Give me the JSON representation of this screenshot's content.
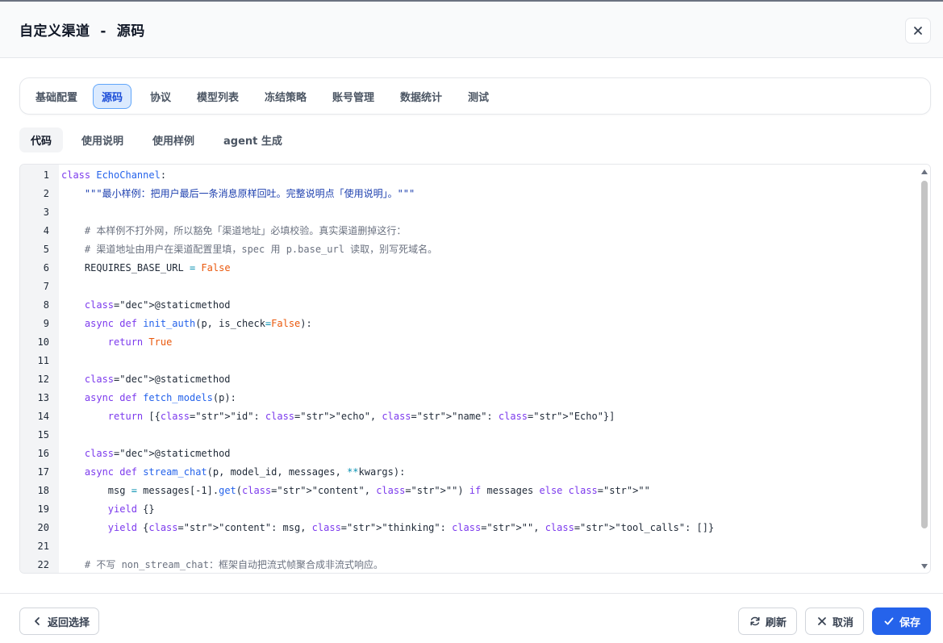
{
  "dialog": {
    "title": "自定义渠道  -  源码",
    "close_icon": "close-icon"
  },
  "tabs": [
    {
      "label": "基础配置",
      "active": false
    },
    {
      "label": "源码",
      "active": true
    },
    {
      "label": "协议",
      "active": false
    },
    {
      "label": "模型列表",
      "active": false
    },
    {
      "label": "冻结策略",
      "active": false
    },
    {
      "label": "账号管理",
      "active": false
    },
    {
      "label": "数据统计",
      "active": false
    },
    {
      "label": "测试",
      "active": false
    }
  ],
  "subtabs": [
    {
      "label": "代码",
      "active": true
    },
    {
      "label": "使用说明",
      "active": false
    },
    {
      "label": "使用样例",
      "active": false
    },
    {
      "label": "agent 生成",
      "active": false
    }
  ],
  "editor": {
    "lines": [
      {
        "n": "1",
        "text": "class EchoChannel:"
      },
      {
        "n": "2",
        "text": "    \"\"\"最小样例：把用户最后一条消息原样回吐。完整说明点「使用说明」。\"\"\""
      },
      {
        "n": "3",
        "text": ""
      },
      {
        "n": "4",
        "text": "    # 本样例不打外网，所以豁免「渠道地址」必填校验。真实渠道删掉这行："
      },
      {
        "n": "5",
        "text": "    # 渠道地址由用户在渠道配置里填，spec 用 p.base_url 读取，别写死域名。"
      },
      {
        "n": "6",
        "text": "    REQUIRES_BASE_URL = False"
      },
      {
        "n": "7",
        "text": ""
      },
      {
        "n": "8",
        "text": "    @staticmethod"
      },
      {
        "n": "9",
        "text": "    async def init_auth(p, is_check=False):"
      },
      {
        "n": "10",
        "text": "        return True"
      },
      {
        "n": "11",
        "text": ""
      },
      {
        "n": "12",
        "text": "    @staticmethod"
      },
      {
        "n": "13",
        "text": "    async def fetch_models(p):"
      },
      {
        "n": "14",
        "text": "        return [{\"id\": \"echo\", \"name\": \"Echo\"}]"
      },
      {
        "n": "15",
        "text": ""
      },
      {
        "n": "16",
        "text": "    @staticmethod"
      },
      {
        "n": "17",
        "text": "    async def stream_chat(p, model_id, messages, **kwargs):"
      },
      {
        "n": "18",
        "text": "        msg = messages[-1].get(\"content\", \"\") if messages else \"\""
      },
      {
        "n": "19",
        "text": "        yield {}"
      },
      {
        "n": "20",
        "text": "        yield {\"content\": msg, \"thinking\": \"\", \"tool_calls\": []}"
      },
      {
        "n": "21",
        "text": ""
      },
      {
        "n": "22",
        "text": "    # 不写 non_stream_chat：框架自动把流式帧聚合成非流式响应。"
      }
    ]
  },
  "footer": {
    "back_label": "返回选择",
    "refresh_label": "刷新",
    "cancel_label": "取消",
    "save_label": "保存",
    "back_icon": "chevron-left-icon",
    "refresh_icon": "refresh-icon",
    "cancel_icon": "x-icon",
    "save_icon": "check-icon"
  },
  "colors": {
    "accent": "#2563eb",
    "active_tab_bg": "#dbeafe",
    "active_tab_border": "#60a5fa"
  }
}
